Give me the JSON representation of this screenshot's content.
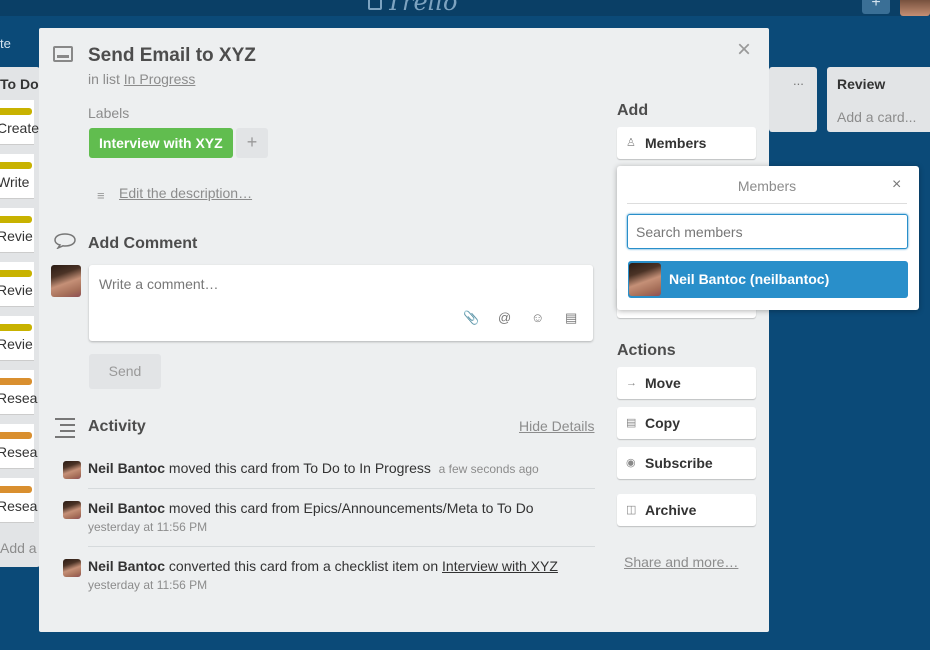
{
  "board": {
    "title_fragment": "te",
    "lists": [
      {
        "title": "To Do",
        "add_card": "Add a"
      },
      {
        "title": "Review",
        "add_card": "Add a card..."
      }
    ],
    "todo_cards": [
      "Create",
      "Write",
      "Revie",
      "Revie",
      "Revie",
      "Resea",
      "Resea",
      "Resea"
    ],
    "todo_label_colors": [
      "#c8b200",
      "#c8b200",
      "#c8b200",
      "#c8b200",
      "#c8b200",
      "#d98f2f",
      "#d98f2f",
      "#d98f2f"
    ],
    "list_menu": "...",
    "top_plus": "+"
  },
  "card": {
    "title": "Send Email to XYZ",
    "in_list_prefix": "in list ",
    "list_name": "In Progress",
    "labels_heading": "Labels",
    "label": {
      "text": "Interview with XYZ",
      "color": "#61bd4f"
    },
    "label_add": "+",
    "edit_description": "Edit the description…",
    "close": "×"
  },
  "comment": {
    "heading": "Add Comment",
    "placeholder": "Write a comment…",
    "send": "Send",
    "tools": [
      "attach-icon",
      "mention-icon",
      "emoji-icon",
      "card-icon"
    ]
  },
  "activity": {
    "heading": "Activity",
    "hide_details": "Hide Details",
    "items": [
      {
        "user": "Neil Bantoc",
        "action": " moved this card from To Do to In Progress",
        "time": "a few seconds ago"
      },
      {
        "user": "Neil Bantoc",
        "action": " moved this card from Epics/Announcements/Meta to To Do",
        "time": "yesterday at 11:56 PM"
      },
      {
        "user": "Neil Bantoc",
        "action": " converted this card from a checklist item on ",
        "link": "Interview with XYZ",
        "time": "yesterday at 11:56 PM"
      }
    ]
  },
  "sidebar": {
    "add_heading": "Add",
    "members_btn": "Members",
    "actions_heading": "Actions",
    "actions": [
      {
        "label": "Move",
        "icon": "arrow-right-icon"
      },
      {
        "label": "Copy",
        "icon": "copy-icon"
      },
      {
        "label": "Subscribe",
        "icon": "eye-icon"
      },
      {
        "label": "Archive",
        "icon": "archive-icon"
      }
    ],
    "share": "Share and more…"
  },
  "members_popover": {
    "title": "Members",
    "close": "×",
    "search_placeholder": "Search members",
    "result": "Neil Bantoc (neilbantoc)",
    "highlight_color": "#298fca"
  }
}
